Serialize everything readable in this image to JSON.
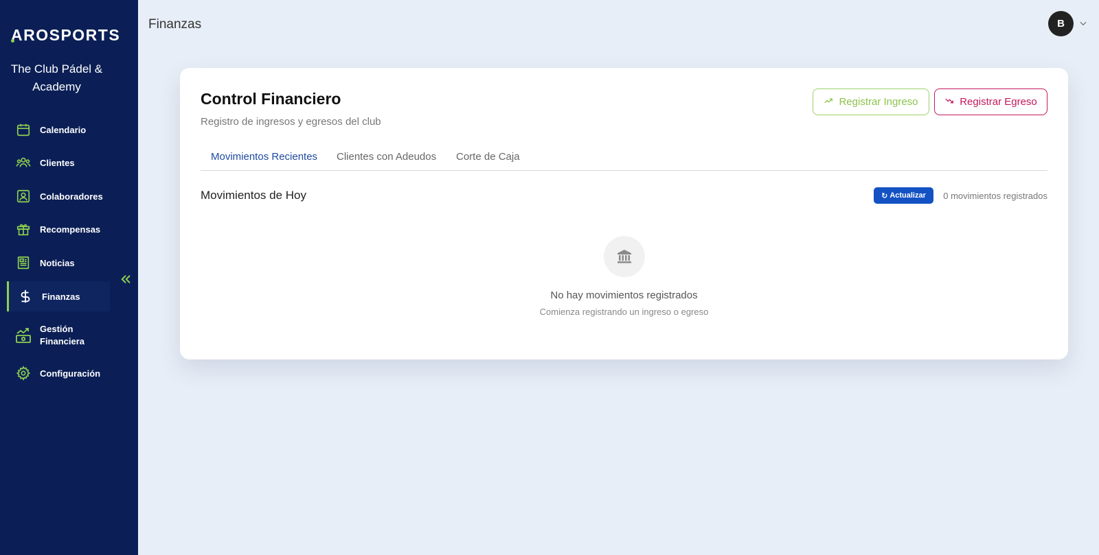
{
  "sidebar": {
    "logo_text": "AROSPORTS",
    "club_name": "The Club Pádel & Academy",
    "items": [
      {
        "label": "Calendario",
        "icon": "calendar-icon"
      },
      {
        "label": "Clientes",
        "icon": "users-icon"
      },
      {
        "label": "Colaboradores",
        "icon": "contact-badge-icon"
      },
      {
        "label": "Recompensas",
        "icon": "gift-icon"
      },
      {
        "label": "Noticias",
        "icon": "newspaper-icon"
      },
      {
        "label": "Finanzas",
        "icon": "dollar-icon",
        "active": true
      },
      {
        "label": "Gestión Financiera",
        "icon": "cash-growth-icon"
      },
      {
        "label": "Configuración",
        "icon": "gear-icon"
      }
    ],
    "collapse_icon": "double-chevron-left-icon"
  },
  "header": {
    "title": "Finanzas",
    "avatar_initial": "B"
  },
  "card": {
    "title": "Control Financiero",
    "subtitle": "Registro de ingresos y egresos del club",
    "btn_ingreso": "Registrar Ingreso",
    "btn_egreso": "Registrar Egreso",
    "tabs": [
      {
        "label": "Movimientos Recientes",
        "active": true
      },
      {
        "label": "Clientes con Adeudos"
      },
      {
        "label": "Corte de Caja"
      }
    ],
    "section_title": "Movimientos de Hoy",
    "refresh_label": "Actualizar",
    "count_text": "0 movimientos registrados",
    "empty_title": "No hay movimientos registrados",
    "empty_subtitle": "Comienza registrando un ingreso o egreso",
    "empty_icon": "bank-icon"
  },
  "colors": {
    "sidebar_bg": "#0b1f56",
    "accent_green": "#8fd14f",
    "egreso_red": "#c2185b",
    "primary_blue": "#1452c4",
    "page_bg": "#e8eef7"
  }
}
